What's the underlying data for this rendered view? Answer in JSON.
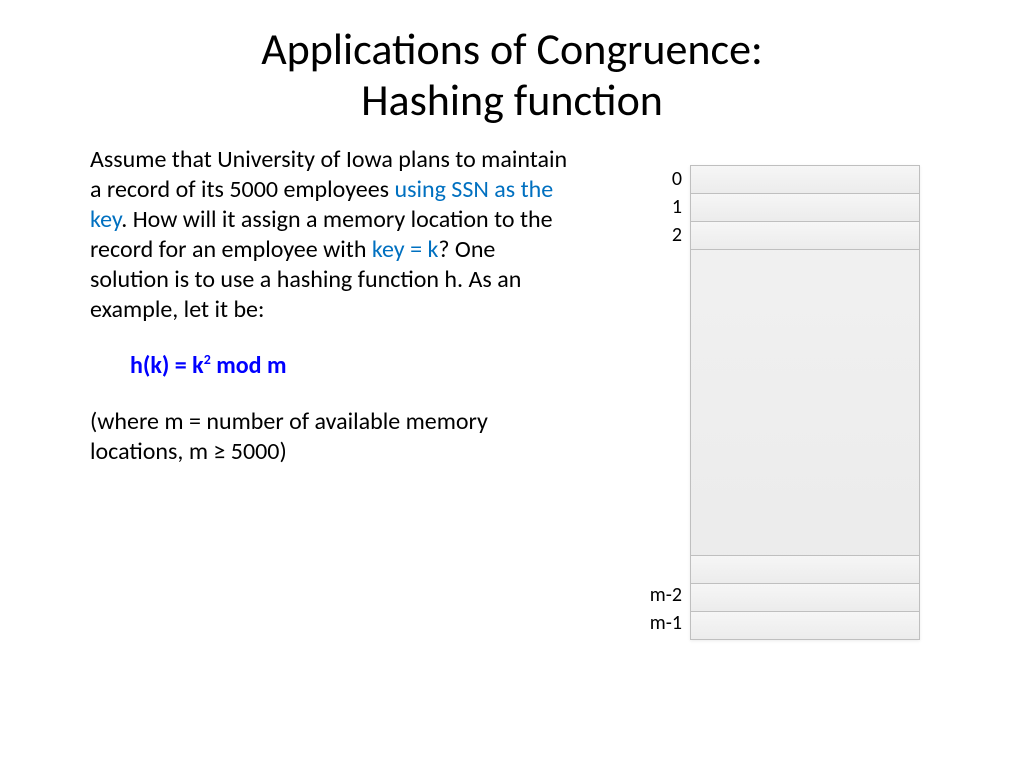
{
  "title_line1": "Applications of Congruence:",
  "title_line2": "Hashing function",
  "body": {
    "p1a": "Assume that University of Iowa plans to maintain a record of its 5000 employees ",
    "p1_blue1": "using SSN as the key",
    "p1b": ". How will it assign a memory location to the record for an employee with ",
    "p1_blue2": "key = k",
    "p1c": "? One solution is to use a hashing function h. As an example, let it be:",
    "formula_prefix": "h(k) = k",
    "formula_sup": "2",
    "formula_suffix": " mod m",
    "p2": "(where m = number of  available memory locations, m ≥ 5000)"
  },
  "labels": {
    "l0": "0",
    "l1": "1",
    "l2": "2",
    "lm2": "m-2",
    "lm1": "m-1"
  }
}
